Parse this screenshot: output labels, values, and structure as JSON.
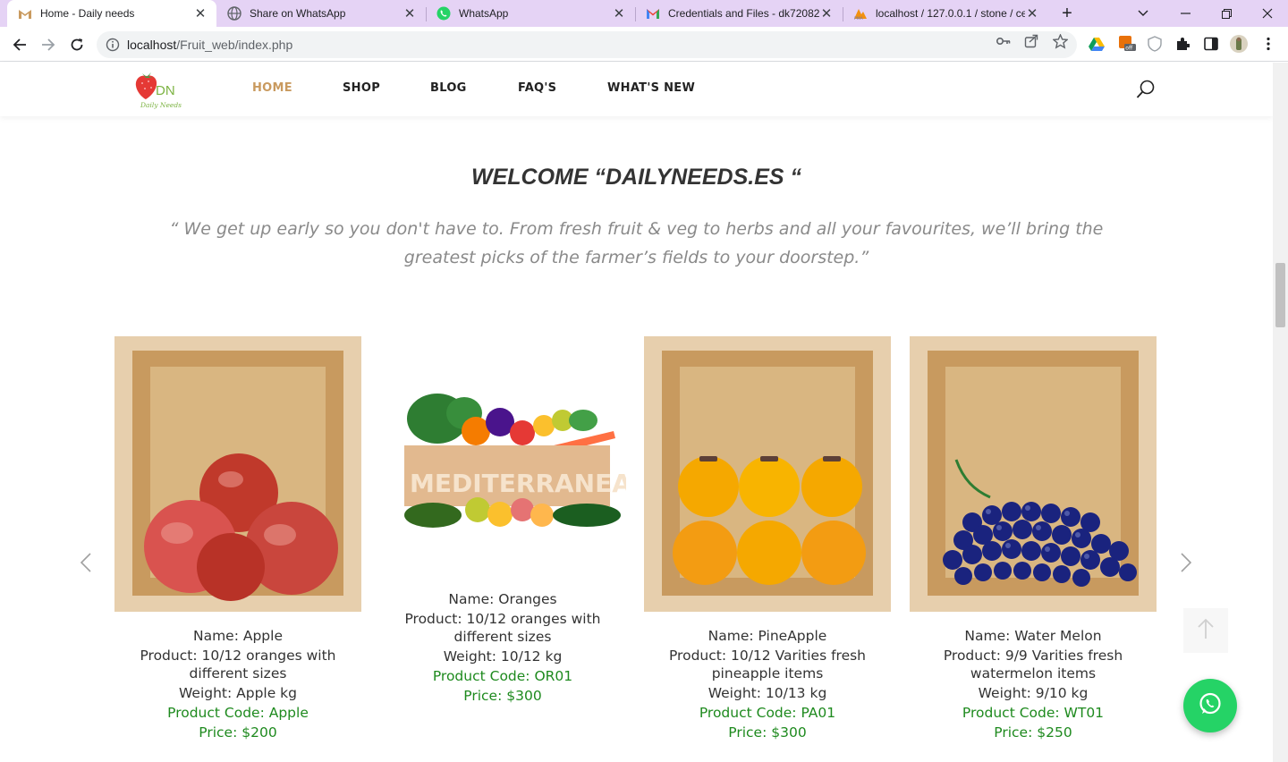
{
  "browser": {
    "tabs": [
      {
        "title": "Home - Daily needs",
        "icon": "gmail-m-icon",
        "active": true
      },
      {
        "title": "Share on WhatsApp",
        "icon": "globe-icon",
        "active": false
      },
      {
        "title": "WhatsApp",
        "icon": "whatsapp-icon",
        "active": false
      },
      {
        "title": "Credentials and Files - dk72082",
        "icon": "gmail-icon",
        "active": false
      },
      {
        "title": "localhost / 127.0.0.1 / stone / ce",
        "icon": "phpmyadmin-icon",
        "active": false
      }
    ],
    "url_host": "localhost",
    "url_path": "/Fruit_web/index.php"
  },
  "site": {
    "logo_text": "DN",
    "logo_script": "Daily Needs",
    "nav": [
      {
        "label": "HOME",
        "active": true
      },
      {
        "label": "SHOP",
        "active": false
      },
      {
        "label": "BLOG",
        "active": false
      },
      {
        "label": "FAQ'S",
        "active": false
      },
      {
        "label": "WHAT'S NEW",
        "active": false
      }
    ]
  },
  "welcome": {
    "title": "WELCOME “DAILYNEEDS.ES “",
    "tagline": "“ We get up early so you don't have to. From fresh fruit & veg to herbs and all your favourites, we’ll bring the greatest picks of the farmer’s fields to your doorstep.”"
  },
  "products": [
    {
      "name": "Name: Apple",
      "product": "Product: 10/12 oranges with different sizes",
      "weight": "Weight: Apple kg",
      "code": "Product Code: Apple",
      "price": "Price: $200",
      "image": "pomegranates-in-crate"
    },
    {
      "name": "Name: Oranges",
      "product": "Product: 10/12 oranges with different sizes",
      "weight": "Weight: 10/12 kg",
      "code": "Product Code: OR01",
      "price": "Price: $300",
      "image": "mediterranean-veg-box",
      "box_label": "MEDITERRANEAN"
    },
    {
      "name": "Name: PineApple",
      "product": "Product: 10/12 Varities fresh pineapple items",
      "weight": "Weight: 10/13 kg",
      "code": "Product Code: PA01",
      "price": "Price: $300",
      "image": "persimmons-in-crate"
    },
    {
      "name": "Name: Water Melon",
      "product": "Product: 9/9 Varities fresh watermelon items",
      "weight": "Weight: 9/10 kg",
      "code": "Product Code: WT01",
      "price": "Price: $250",
      "image": "grapes-in-crate"
    }
  ],
  "colors": {
    "accent_nav": "#c99a5f",
    "green_text": "#1e8a1e",
    "whatsapp": "#25d366",
    "tabstrip": "#e5d3f5"
  }
}
